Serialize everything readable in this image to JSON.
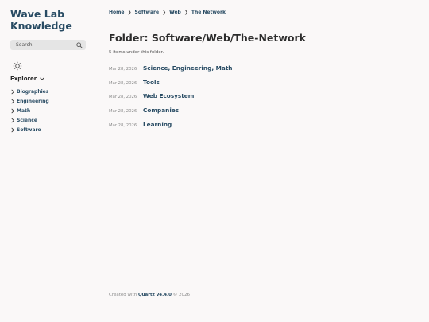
{
  "site": {
    "title_line1": "Wave Lab",
    "title_line2": "Knowledge"
  },
  "search": {
    "placeholder": "Search"
  },
  "explorer": {
    "title": "Explorer",
    "items": [
      {
        "label": "Biographies"
      },
      {
        "label": "Engineering"
      },
      {
        "label": "Math"
      },
      {
        "label": "Science"
      },
      {
        "label": "Software"
      }
    ]
  },
  "breadcrumb": [
    {
      "label": "Home"
    },
    {
      "label": "Software"
    },
    {
      "label": "Web"
    },
    {
      "label": "The Network"
    }
  ],
  "breadcrumb_separator": "❯",
  "page": {
    "title": "Folder: Software/Web/The-Network",
    "count_text": "5 items under this folder."
  },
  "items": [
    {
      "date": "Mar 28, 2026",
      "title": "Science, Engineering, Math"
    },
    {
      "date": "Mar 28, 2026",
      "title": "Tools"
    },
    {
      "date": "Mar 28, 2026",
      "title": "Web Ecosystem"
    },
    {
      "date": "Mar 28, 2026",
      "title": "Companies"
    },
    {
      "date": "Mar 28, 2026",
      "title": "Learning"
    }
  ],
  "footer": {
    "prefix": "Created with",
    "link": "Quartz v4.4.0",
    "suffix": "© 2026"
  }
}
